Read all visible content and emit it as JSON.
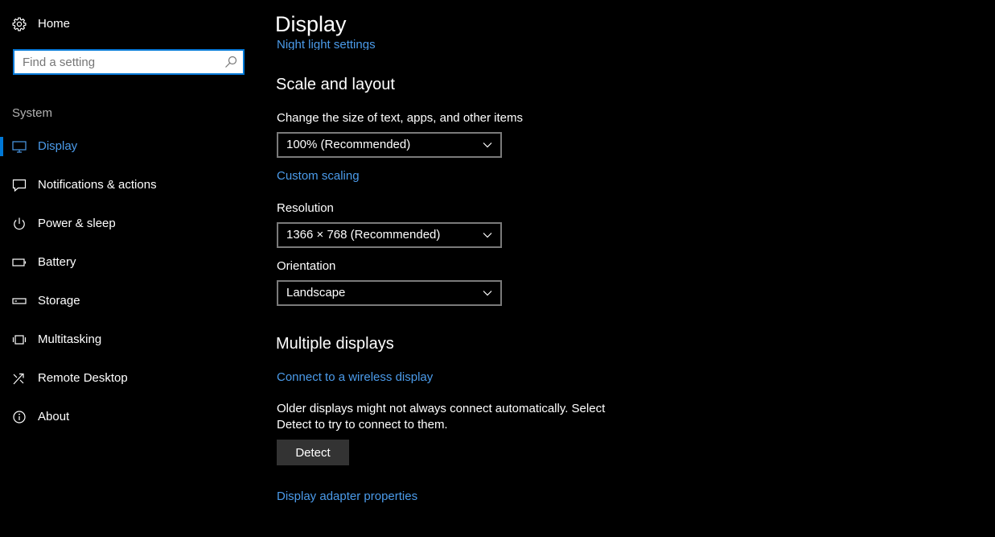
{
  "sidebar": {
    "home_label": "Home",
    "search": {
      "placeholder": "Find a setting",
      "value": ""
    },
    "group_label": "System",
    "items": [
      {
        "label": "Display",
        "icon": "monitor-icon",
        "active": true
      },
      {
        "label": "Notifications & actions",
        "icon": "notification-icon",
        "active": false
      },
      {
        "label": "Power & sleep",
        "icon": "power-icon",
        "active": false
      },
      {
        "label": "Battery",
        "icon": "battery-icon",
        "active": false
      },
      {
        "label": "Storage",
        "icon": "storage-icon",
        "active": false
      },
      {
        "label": "Multitasking",
        "icon": "multitasking-icon",
        "active": false
      },
      {
        "label": "Remote Desktop",
        "icon": "remote-desktop-icon",
        "active": false
      },
      {
        "label": "About",
        "icon": "info-icon",
        "active": false
      }
    ]
  },
  "main": {
    "title": "Display",
    "night_light_link": "Night light settings",
    "scale_section": {
      "heading": "Scale and layout",
      "size_label": "Change the size of text, apps, and other items",
      "size_value": "100% (Recommended)",
      "custom_scaling_link": "Custom scaling",
      "resolution_label": "Resolution",
      "resolution_value": "1366 × 768 (Recommended)",
      "orientation_label": "Orientation",
      "orientation_value": "Landscape"
    },
    "multiple_displays": {
      "heading": "Multiple displays",
      "wireless_link": "Connect to a wireless display",
      "description": "Older displays might not always connect automatically. Select Detect to try to connect to them.",
      "detect_button": "Detect",
      "adapter_link": "Display adapter properties"
    }
  },
  "colors": {
    "background": "#000000",
    "accent": "#0078d7",
    "link": "#4b9bea",
    "text": "#ffffff",
    "muted": "#b3b3b3",
    "button_bg": "#333333"
  }
}
